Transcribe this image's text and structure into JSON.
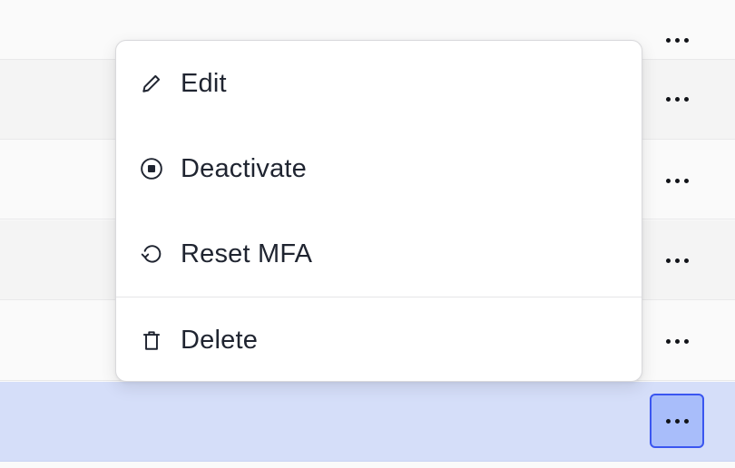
{
  "menu": {
    "items": [
      {
        "label": "Edit",
        "icon": "pencil-icon"
      },
      {
        "label": "Deactivate",
        "icon": "stop-circle-icon"
      },
      {
        "label": "Reset MFA",
        "icon": "reset-icon"
      },
      {
        "label": "Delete",
        "icon": "trash-icon"
      }
    ]
  },
  "table": {
    "row_action_icon": "more-horizontal-icon",
    "selected_row_index": 5,
    "accent_color": "#3a56f0",
    "selected_row_color": "#d5def9"
  }
}
